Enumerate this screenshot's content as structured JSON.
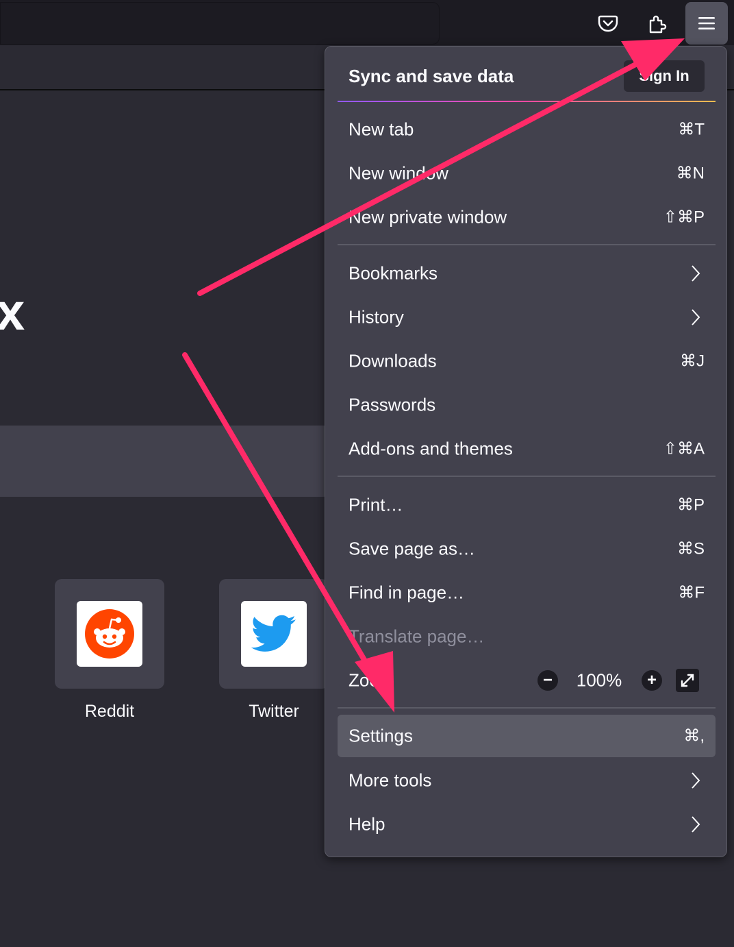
{
  "toolbar": {
    "icons": [
      "pocket-icon",
      "extensions-icon",
      "hamburger-menu-icon"
    ]
  },
  "newtab": {
    "logo_partial": "x",
    "shortcuts": [
      {
        "label": "Reddit",
        "icon": "reddit-icon",
        "color": "#ff4500"
      },
      {
        "label": "Twitter",
        "icon": "twitter-icon",
        "color": "#1d9bf0"
      }
    ]
  },
  "menu": {
    "header": {
      "title": "Sync and save data",
      "signin_label": "Sign In"
    },
    "group1": [
      {
        "label": "New tab",
        "shortcut": "⌘T"
      },
      {
        "label": "New window",
        "shortcut": "⌘N"
      },
      {
        "label": "New private window",
        "shortcut": "⇧⌘P"
      }
    ],
    "group2": [
      {
        "label": "Bookmarks",
        "submenu": true
      },
      {
        "label": "History",
        "submenu": true
      },
      {
        "label": "Downloads",
        "shortcut": "⌘J"
      },
      {
        "label": "Passwords",
        "shortcut": ""
      },
      {
        "label": "Add-ons and themes",
        "shortcut": "⇧⌘A"
      }
    ],
    "group3": [
      {
        "label": "Print…",
        "shortcut": "⌘P"
      },
      {
        "label": "Save page as…",
        "shortcut": "⌘S"
      },
      {
        "label": "Find in page…",
        "shortcut": "⌘F"
      },
      {
        "label": "Translate page…",
        "disabled": true
      }
    ],
    "zoom": {
      "label": "Zoom",
      "minus": "−",
      "value": "100%",
      "plus": "+"
    },
    "group4": [
      {
        "label": "Settings",
        "shortcut": "⌘,",
        "highlighted": true
      },
      {
        "label": "More tools",
        "submenu": true
      },
      {
        "label": "Help",
        "submenu": true
      }
    ]
  },
  "annotation": {
    "arrow_color": "#ff2a68"
  }
}
